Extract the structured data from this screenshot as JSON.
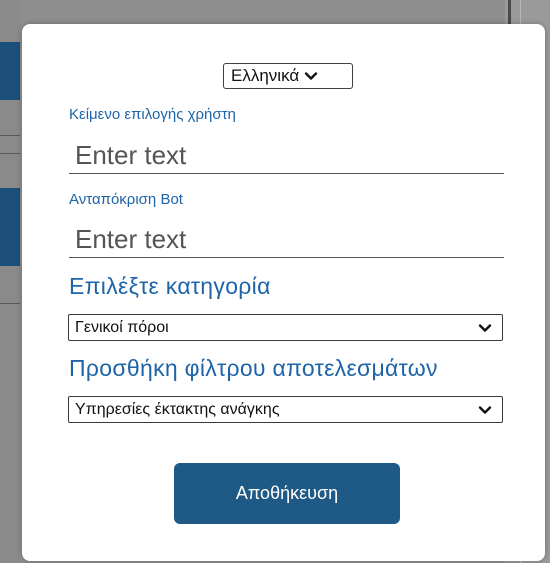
{
  "modal": {
    "language_select": {
      "value": "Ελληνικά"
    },
    "user_text": {
      "label": "Κείμενο επιλογής χρήστη",
      "placeholder": "Enter text"
    },
    "bot_response": {
      "label": "Ανταπόκριση Bot",
      "placeholder": "Enter text"
    },
    "category": {
      "heading": "Επιλέξτε κατηγορία",
      "value": "Γενικοί πόροι"
    },
    "result_filter": {
      "heading": "Προσθήκη φίλτρου αποτελεσμάτων",
      "value": "Υπηρεσίες έκτακτης ανάγκης"
    },
    "save_label": "Αποθήκευση"
  },
  "icons": {
    "dropdown": "chevron-down-icon"
  },
  "colors": {
    "accent": "#1e64a8",
    "button": "#1f5a86",
    "overlay": "#8e8e8e",
    "background_blue": "#1c4f7a"
  }
}
